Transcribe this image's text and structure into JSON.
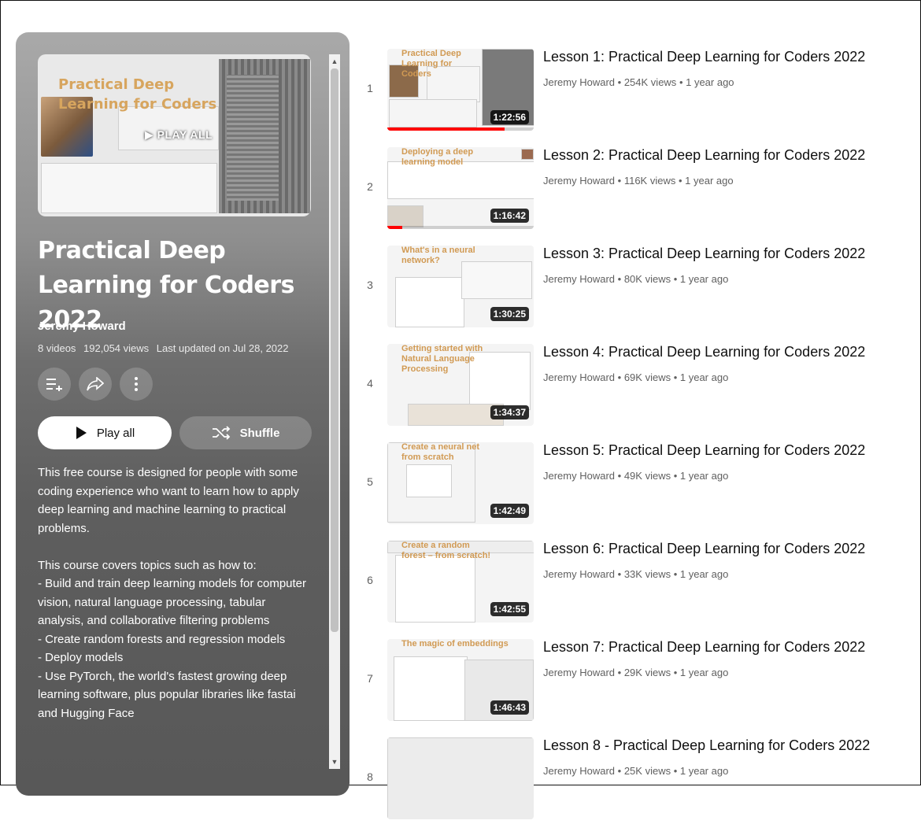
{
  "playlist": {
    "cover_title_line1": "Practical Deep",
    "cover_title_line2": "Learning for Coders",
    "cover_overlay": "PLAY ALL",
    "title": "Practical Deep Learning for Coders 2022",
    "owner": "Jeremy Howard",
    "video_count": "8 videos",
    "views": "192,054 views",
    "updated": "Last updated on Jul 28, 2022",
    "play_all_label": "Play all",
    "shuffle_label": "Shuffle",
    "description": [
      "This free course is designed for people with some coding experience who want to learn how to apply deep learning and machine learning to practical problems.",
      "",
      "This course covers topics such as how to:",
      "- Build and train deep learning models for computer vision, natural language processing, tabular analysis, and collaborative filtering problems",
      "- Create random forests and regression models",
      "- Deploy models",
      "- Use PyTorch, the world's fastest growing deep learning software, plus popular libraries like fastai and Hugging Face"
    ],
    "icons": {
      "save": "add-to-playlist-icon",
      "share": "share-icon",
      "more": "more-vert-icon",
      "play": "play-icon",
      "shuffle": "shuffle-icon"
    }
  },
  "videos": [
    {
      "index": "1",
      "title": "Lesson 1: Practical Deep Learning for Coders 2022",
      "channel": "Jeremy Howard",
      "views": "254K views",
      "age": "1 year ago",
      "duration": "1:22:56",
      "thumb_text": "Practical Deep Learning for Coders",
      "watched_fraction": 0.8
    },
    {
      "index": "2",
      "title": "Lesson 2: Practical Deep Learning for Coders 2022",
      "channel": "Jeremy Howard",
      "views": "116K views",
      "age": "1 year ago",
      "duration": "1:16:42",
      "thumb_text": "Deploying a deep learning model",
      "watched_fraction": 0.1
    },
    {
      "index": "3",
      "title": "Lesson 3: Practical Deep Learning for Coders 2022",
      "channel": "Jeremy Howard",
      "views": "80K views",
      "age": "1 year ago",
      "duration": "1:30:25",
      "thumb_text": "What's in a neural network?",
      "watched_fraction": 0
    },
    {
      "index": "4",
      "title": "Lesson 4: Practical Deep Learning for Coders 2022",
      "channel": "Jeremy Howard",
      "views": "69K views",
      "age": "1 year ago",
      "duration": "1:34:37",
      "thumb_text": "Getting started with Natural Language Processing",
      "watched_fraction": 0
    },
    {
      "index": "5",
      "title": "Lesson 5: Practical Deep Learning for Coders 2022",
      "channel": "Jeremy Howard",
      "views": "49K views",
      "age": "1 year ago",
      "duration": "1:42:49",
      "thumb_text": "Create a neural net from scratch",
      "watched_fraction": 0
    },
    {
      "index": "6",
      "title": "Lesson 6: Practical Deep Learning for Coders 2022",
      "channel": "Jeremy Howard",
      "views": "33K views",
      "age": "1 year ago",
      "duration": "1:42:55",
      "thumb_text": "Create a random forest – from scratch!",
      "watched_fraction": 0
    },
    {
      "index": "7",
      "title": "Lesson 7: Practical Deep Learning for Coders 2022",
      "channel": "Jeremy Howard",
      "views": "29K views",
      "age": "1 year ago",
      "duration": "1:46:43",
      "thumb_text": "The magic of embeddings",
      "watched_fraction": 0
    },
    {
      "index": "8",
      "title": "Lesson 8 - Practical Deep Learning for Coders 2022",
      "channel": "Jeremy Howard",
      "views": "25K views",
      "age": "1 year ago",
      "duration": "",
      "thumb_text": "",
      "watched_fraction": 0
    }
  ]
}
